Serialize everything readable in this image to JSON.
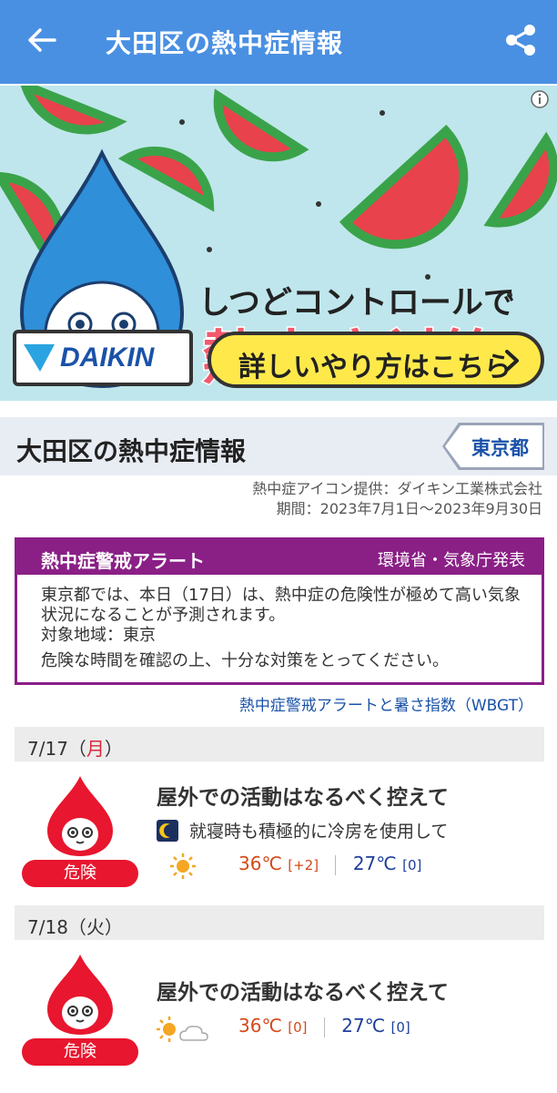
{
  "header": {
    "title": "大田区の熱中症情報"
  },
  "banner": {
    "headline": "しつどコントロールで",
    "headline_big": "熱中症対策",
    "logo_text": "DAIKIN",
    "cta_label": "詳しいやり方はこちら"
  },
  "section": {
    "title": "大田区の熱中症情報",
    "prefecture": "東京都",
    "credit_line1": "熱中症アイコン提供：ダイキン工業株式会社",
    "credit_line2": "期間：2023年7月1日〜2023年9月30日"
  },
  "alert": {
    "title": "熱中症警戒アラート",
    "source": "環境省・気象庁発表",
    "line1": "東京都では、本日（17日）は、熱中症の危険性が極めて高い気象状況になることが予測されます。",
    "line2": "対象地域：東京",
    "line3": "危険な時間を確認の上、十分な対策をとってください。"
  },
  "wbgt_link": "熱中症警戒アラートと暑さ指数（WBGT）",
  "days": [
    {
      "date": "7/17",
      "weekday_open": "（",
      "weekday": "月",
      "weekday_close": "）",
      "level": "危険",
      "advice": "屋外での活動はなるべく控えて",
      "night_advice": "就寝時も積極的に冷房を使用して",
      "max_temp": "36℃",
      "max_diff": "[+2]",
      "min_temp": "27℃",
      "min_diff": "[0]"
    },
    {
      "date": "7/18",
      "weekday_open": "（",
      "weekday": "火",
      "weekday_close": "）",
      "level": "危険",
      "advice": "屋外での活動はなるべく控えて",
      "max_temp": "36℃",
      "max_diff": "[0]",
      "min_temp": "27℃",
      "min_diff": "[0]"
    }
  ],
  "colors": {
    "appbar": "#4a90e2",
    "alert": "#8a1f86",
    "danger": "#e8162e",
    "link": "#1a52a8"
  },
  "icons": [
    "back-arrow-icon",
    "share-icon",
    "info-icon",
    "chevron-right-icon",
    "moon-icon",
    "sun-icon",
    "sun-cloud-icon"
  ]
}
